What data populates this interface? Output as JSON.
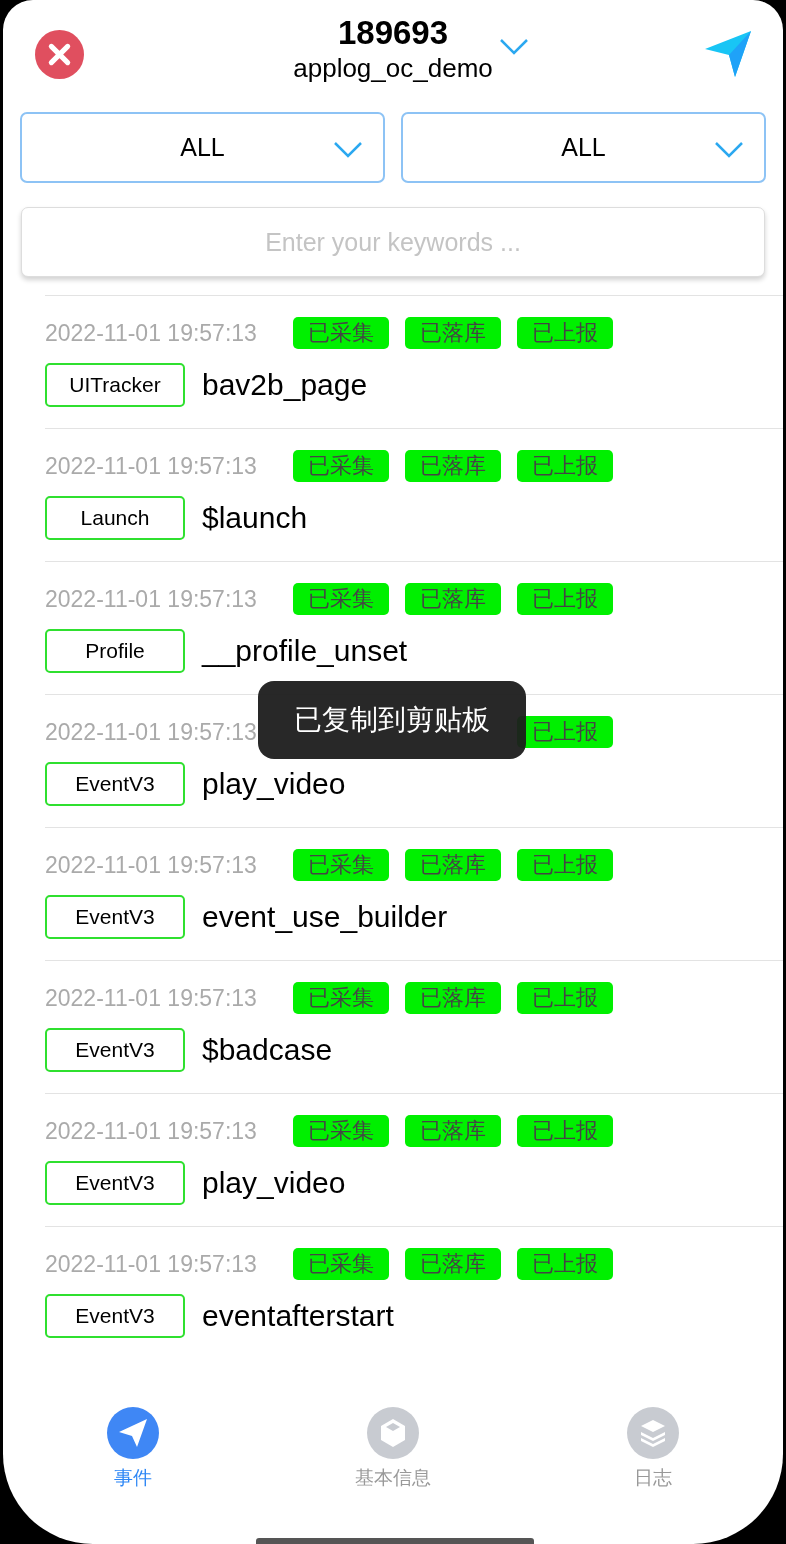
{
  "header": {
    "title": "189693",
    "subtitle": "applog_oc_demo"
  },
  "filters": [
    {
      "value": "ALL"
    },
    {
      "value": "ALL"
    }
  ],
  "search": {
    "placeholder": "Enter your keywords ..."
  },
  "events": [
    {
      "time": "2022-11-01 19:57:13",
      "statuses": [
        "已采集",
        "已落库",
        "已上报"
      ],
      "type": "UITracker",
      "name": "bav2b_page"
    },
    {
      "time": "2022-11-01 19:57:13",
      "statuses": [
        "已采集",
        "已落库",
        "已上报"
      ],
      "type": "Launch",
      "name": "$launch"
    },
    {
      "time": "2022-11-01 19:57:13",
      "statuses": [
        "已采集",
        "已落库",
        "已上报"
      ],
      "type": "Profile",
      "name": "__profile_unset"
    },
    {
      "time": "2022-11-01 19:57:13",
      "statuses": [
        "已上报"
      ],
      "type": "EventV3",
      "name": "play_video"
    },
    {
      "time": "2022-11-01 19:57:13",
      "statuses": [
        "已采集",
        "已落库",
        "已上报"
      ],
      "type": "EventV3",
      "name": "event_use_builder"
    },
    {
      "time": "2022-11-01 19:57:13",
      "statuses": [
        "已采集",
        "已落库",
        "已上报"
      ],
      "type": "EventV3",
      "name": "$badcase"
    },
    {
      "time": "2022-11-01 19:57:13",
      "statuses": [
        "已采集",
        "已落库",
        "已上报"
      ],
      "type": "EventV3",
      "name": "play_video"
    },
    {
      "time": "2022-11-01 19:57:13",
      "statuses": [
        "已采集",
        "已落库",
        "已上报"
      ],
      "type": "EventV3",
      "name": "eventafterstart"
    }
  ],
  "toast": "已复制到剪贴板",
  "tabs": [
    {
      "label": "事件",
      "selected": true
    },
    {
      "label": "基本信息",
      "selected": false
    },
    {
      "label": "日志",
      "selected": false
    }
  ]
}
